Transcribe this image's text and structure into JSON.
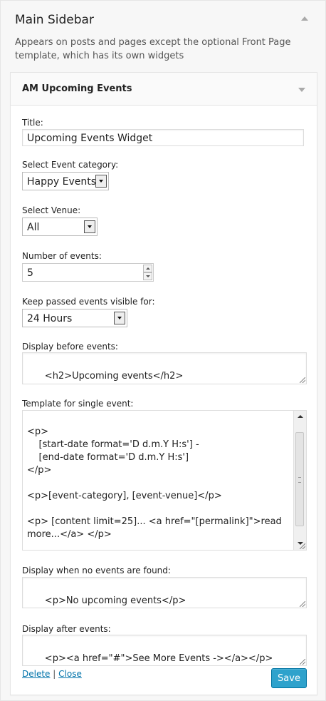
{
  "sidebar": {
    "title": "Main Sidebar",
    "description": "Appears on posts and pages except the optional Front Page template, which has its own widgets"
  },
  "widget": {
    "title": "AM Upcoming Events",
    "fields": {
      "title_label": "Title:",
      "title_value": "Upcoming Events Widget",
      "category_label": "Select Event category:",
      "category_value": "Happy Events",
      "venue_label": "Select Venue:",
      "venue_value": "All",
      "number_label": "Number of events:",
      "number_value": "5",
      "keep_label": "Keep passed events visible for:",
      "keep_value": "24 Hours",
      "before_label": "Display before events:",
      "before_value": "<h2>Upcoming events</h2>",
      "template_label": "Template for single event:",
      "template_value": "<p>\n    [start-date format='D d.m.Y H:s'] -\n    [end-date format='D d.m.Y H:s']\n</p>\n\n<p>[event-category], [event-venue]</p>\n\n<p> [content limit=25]... <a href=\"[permalink]\">read more...</a> </p>",
      "noevents_label": "Display when no events are found:",
      "noevents_value": "<p>No upcoming events</p>",
      "after_label": "Display after events:",
      "after_value": "<p><a href=\"#\">See More Events -></a></p>"
    },
    "actions": {
      "delete": "Delete",
      "separator": "|",
      "close": "Close",
      "save": "Save"
    }
  },
  "colors": {
    "save_button": "#2ea2cc",
    "link": "#0073aa"
  }
}
